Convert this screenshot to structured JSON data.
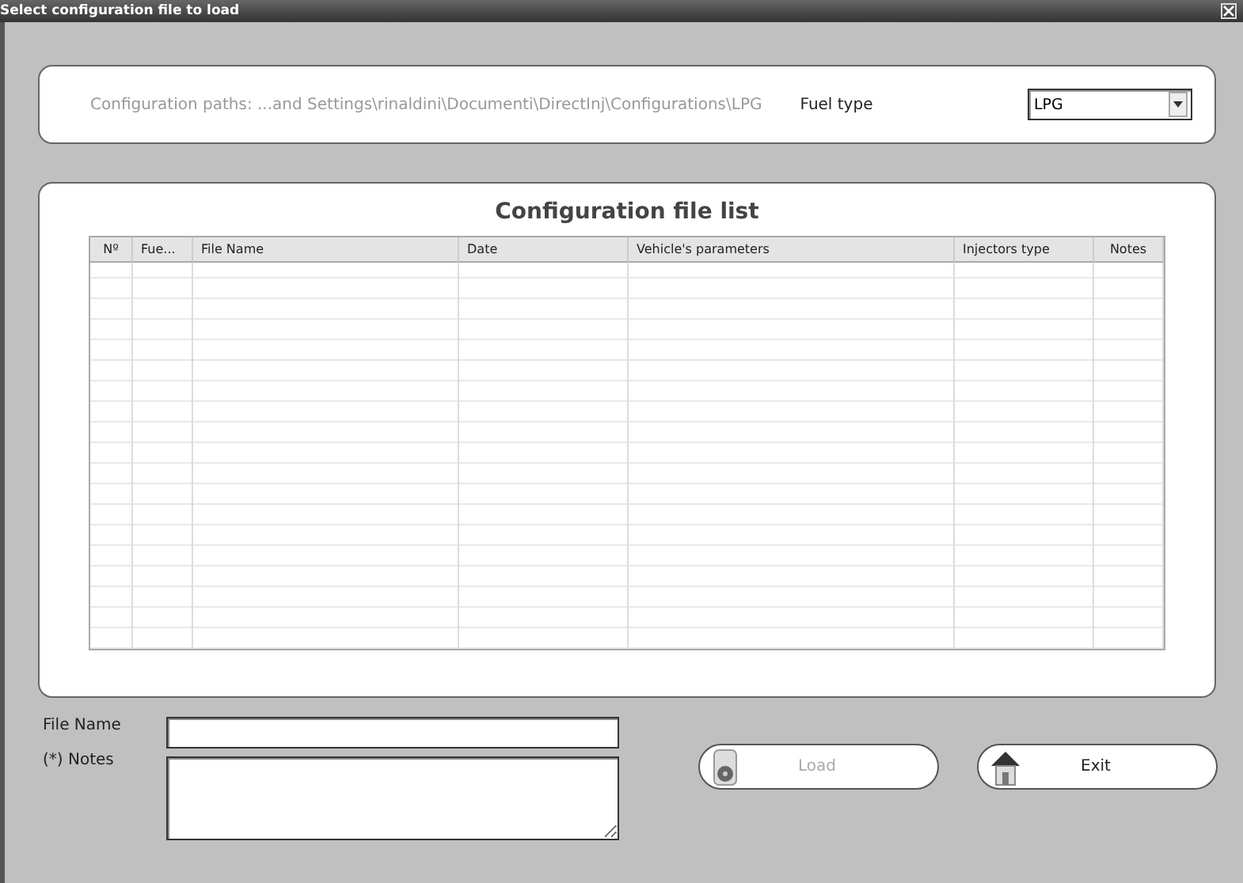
{
  "window": {
    "title": "Select configuration file to load"
  },
  "paths": {
    "label": "Configuration paths:",
    "value": "...and Settings\\rinaldini\\Documenti\\DirectInj\\Configurations\\LPG"
  },
  "fuel_type": {
    "label": "Fuel type",
    "value": "LPG"
  },
  "table": {
    "title": "Configuration file list",
    "columns": [
      "Nº",
      "Fue...",
      "File Name",
      "Date",
      "Vehicle's parameters",
      "Injectors type",
      "Notes"
    ]
  },
  "form": {
    "file_name_label": "File Name",
    "notes_label": "(*) Notes"
  },
  "buttons": [
    {
      "label": "Load",
      "kind": "load",
      "disabled": true
    },
    {
      "label": "Exit",
      "kind": "exit",
      "disabled": false
    }
  ]
}
